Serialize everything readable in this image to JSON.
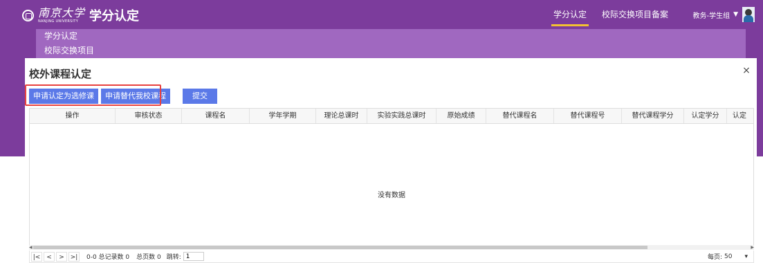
{
  "header": {
    "univ_cn": "南京大学",
    "univ_en": "NANJING UNIVERSITY",
    "system_name": "学分认定",
    "nav": [
      "学分认定",
      "校际交换项目备案"
    ],
    "user": "教务-学生组",
    "colors": {
      "primary": "#7c3c9c",
      "subnav": "#a068c0",
      "active_underline": "#f3c231"
    }
  },
  "subnav": [
    "学分认定",
    "校际交换项目"
  ],
  "modal": {
    "title": "校外课程认定",
    "close": "×",
    "buttons": {
      "apply_elective": "申请认定为选修课",
      "apply_substitute": "申请替代我校课程",
      "submit": "提交"
    },
    "columns": [
      "操作",
      "审核状态",
      "课程名",
      "学年学期",
      "理论总课时",
      "实验实践总课时",
      "原始成绩",
      "替代课程名",
      "替代课程号",
      "替代课程学分",
      "认定学分",
      "认定"
    ],
    "empty_text": "没有数据",
    "pager": {
      "first": "|<",
      "prev": "<",
      "next": ">",
      "last": ">|",
      "info": "0-0 总记录数 0",
      "pages": "总页数 0",
      "jump_label": "跳转:",
      "jump_value": "1",
      "per_page_label": "每页:",
      "per_page_value": "50"
    }
  }
}
